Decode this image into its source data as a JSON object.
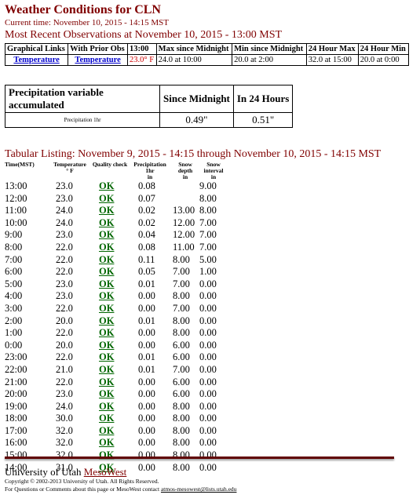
{
  "header": {
    "title": "Weather Conditions for CLN",
    "current_time": "Current time: November 10, 2015 - 14:15 MST",
    "recent_heading": "Most Recent Observations at November 10, 2015 - 13:00 MST"
  },
  "observations": {
    "headers": [
      "Graphical Links",
      "With Prior Obs",
      "13:00",
      "Max since Midnight",
      "Min since Midnight",
      "24 Hour Max",
      "24 Hour Min"
    ],
    "row": {
      "link1": "Temperature",
      "link2": "Temperature",
      "current": "23.0° F",
      "max_midnight": "24.0 at 10:00",
      "min_midnight": "20.0 at 2:00",
      "max_24": "32.0 at 15:00",
      "min_24": "20.0 at 0:00"
    },
    "current_color": "#d00000"
  },
  "precip": {
    "headers": [
      "Precipitation variable accumulated",
      "Since Midnight",
      "In 24 Hours"
    ],
    "label": "Precipitation 1hr",
    "since_midnight": "0.49\"",
    "in_24": "0.51\""
  },
  "listing": {
    "heading": "Tabular Listing: November 9, 2015 - 14:15 through November 10, 2015 - 14:15 MST",
    "columns": {
      "time": "Time(MST)",
      "temp": "Temperature",
      "temp_unit": "° F",
      "qc": "Quality check",
      "precip": "Precipitation 1hr",
      "precip_unit": "in",
      "depth": "Snow depth",
      "depth_unit": "in",
      "interval": "Snow interval",
      "interval_unit": "in"
    },
    "rows": [
      [
        "13:00",
        "23.0",
        "OK",
        "0.08",
        "",
        "9.00"
      ],
      [
        "12:00",
        "23.0",
        "OK",
        "0.07",
        "",
        "8.00"
      ],
      [
        "11:00",
        "24.0",
        "OK",
        "0.02",
        "13.00",
        "8.00"
      ],
      [
        "10:00",
        "24.0",
        "OK",
        "0.02",
        "12.00",
        "7.00"
      ],
      [
        "9:00",
        "23.0",
        "OK",
        "0.04",
        "12.00",
        "7.00"
      ],
      [
        "8:00",
        "22.0",
        "OK",
        "0.08",
        "11.00",
        "7.00"
      ],
      [
        "7:00",
        "22.0",
        "OK",
        "0.11",
        "8.00",
        "5.00"
      ],
      [
        "6:00",
        "22.0",
        "OK",
        "0.05",
        "7.00",
        "1.00"
      ],
      [
        "5:00",
        "23.0",
        "OK",
        "0.01",
        "7.00",
        "0.00"
      ],
      [
        "4:00",
        "23.0",
        "OK",
        "0.00",
        "8.00",
        "0.00"
      ],
      [
        "3:00",
        "22.0",
        "OK",
        "0.00",
        "7.00",
        "0.00"
      ],
      [
        "2:00",
        "20.0",
        "OK",
        "0.01",
        "8.00",
        "0.00"
      ],
      [
        "1:00",
        "22.0",
        "OK",
        "0.00",
        "8.00",
        "0.00"
      ],
      [
        "0:00",
        "20.0",
        "OK",
        "0.00",
        "6.00",
        "0.00"
      ],
      [
        "23:00",
        "22.0",
        "OK",
        "0.01",
        "6.00",
        "0.00"
      ],
      [
        "22:00",
        "21.0",
        "OK",
        "0.01",
        "7.00",
        "0.00"
      ],
      [
        "21:00",
        "22.0",
        "OK",
        "0.00",
        "6.00",
        "0.00"
      ],
      [
        "20:00",
        "23.0",
        "OK",
        "0.00",
        "6.00",
        "0.00"
      ],
      [
        "19:00",
        "24.0",
        "OK",
        "0.00",
        "8.00",
        "0.00"
      ],
      [
        "18:00",
        "30.0",
        "OK",
        "0.00",
        "8.00",
        "0.00"
      ],
      [
        "17:00",
        "32.0",
        "OK",
        "0.00",
        "8.00",
        "0.00"
      ],
      [
        "16:00",
        "32.0",
        "OK",
        "0.00",
        "8.00",
        "0.00"
      ],
      [
        "15:00",
        "32.0",
        "OK",
        "0.00",
        "8.00",
        "0.00"
      ],
      [
        "14:00",
        "31.0",
        "OK",
        "0.00",
        "8.00",
        "0.00"
      ]
    ]
  },
  "footer": {
    "org": "University of Utah",
    "link": "MesoWest",
    "copyright": "Copyright © 2002-2013 University of Utah. All Rights Reserved.",
    "contact_prefix": "For Questions or Comments about this page or MesoWest contact",
    "contact_email": "atmos-mesowest@lists.utah.edu"
  },
  "colors": {
    "heading": "#800000",
    "ok_link": "#006600",
    "link": "#0000cc",
    "rule": "#600000"
  }
}
